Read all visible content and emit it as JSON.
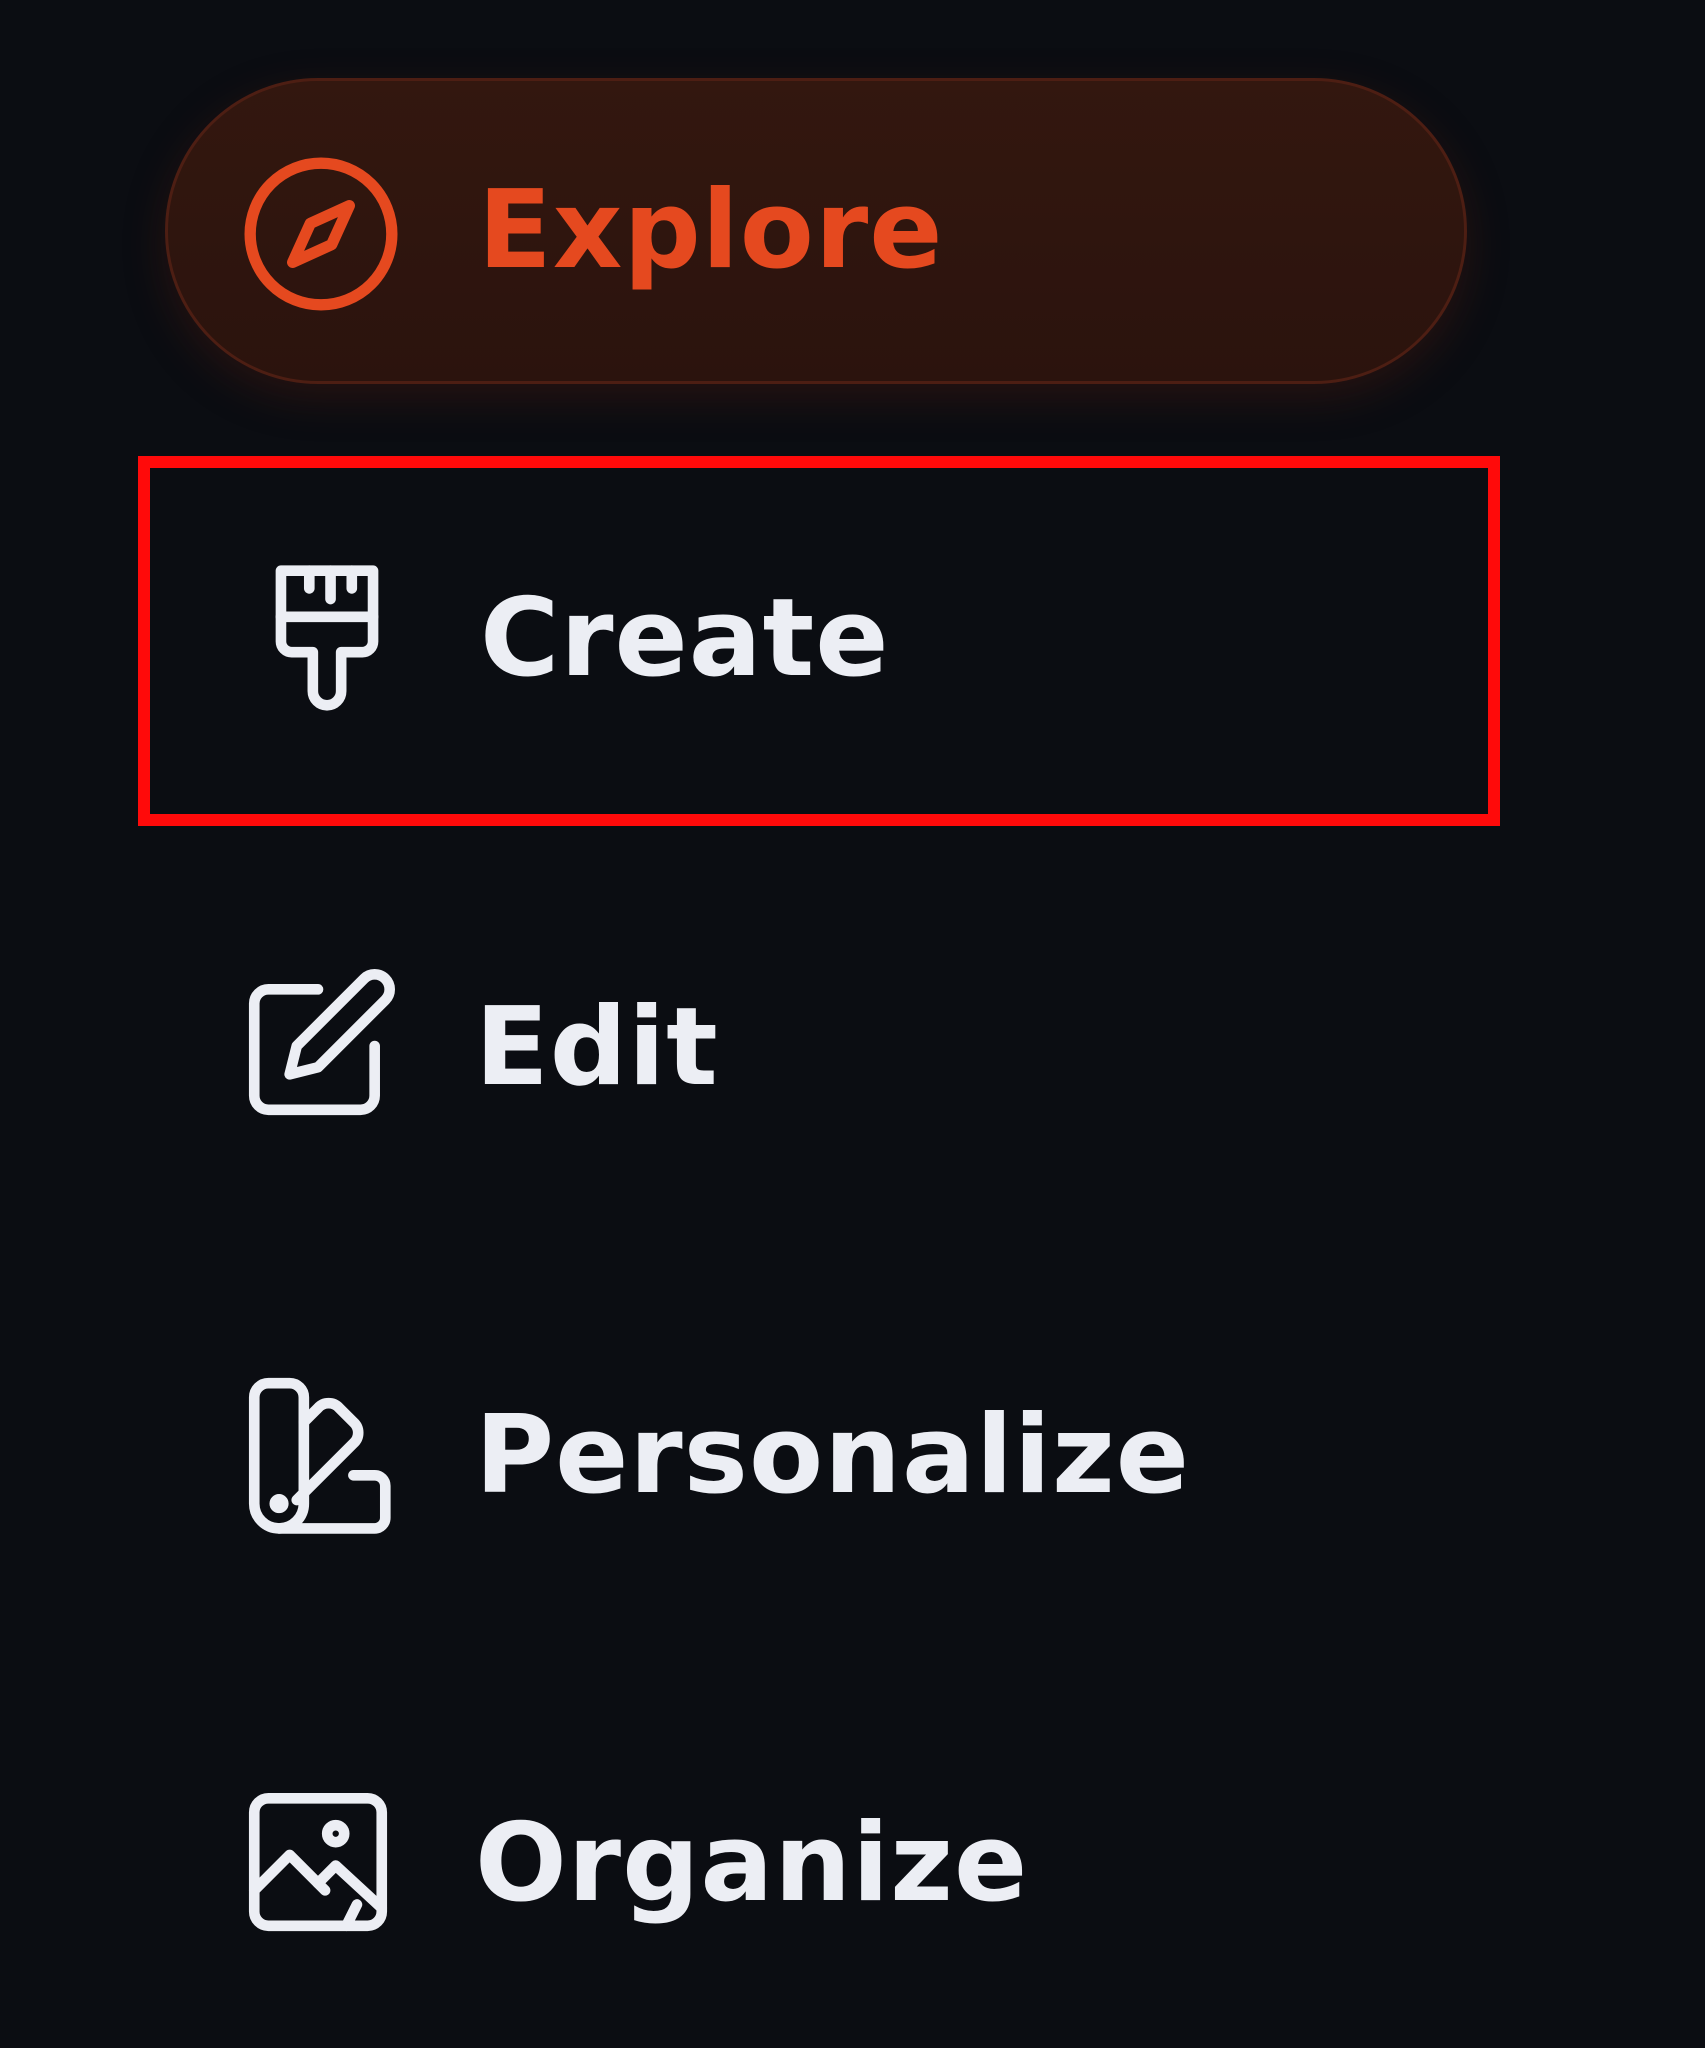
{
  "sidebar": {
    "items": [
      {
        "label": "Explore",
        "icon": "compass-icon",
        "active": true
      },
      {
        "label": "Create",
        "icon": "paintbrush-icon",
        "active": false
      },
      {
        "label": "Edit",
        "icon": "edit-icon",
        "active": false
      },
      {
        "label": "Personalize",
        "icon": "swatches-icon",
        "active": false
      },
      {
        "label": "Organize",
        "icon": "image-icon",
        "active": false
      }
    ]
  },
  "colors": {
    "background": "#0b0d12",
    "accent": "#e5491f",
    "active_background": "#2e150e",
    "text": "#eceef4",
    "highlight_box": "#ff0a0a"
  }
}
